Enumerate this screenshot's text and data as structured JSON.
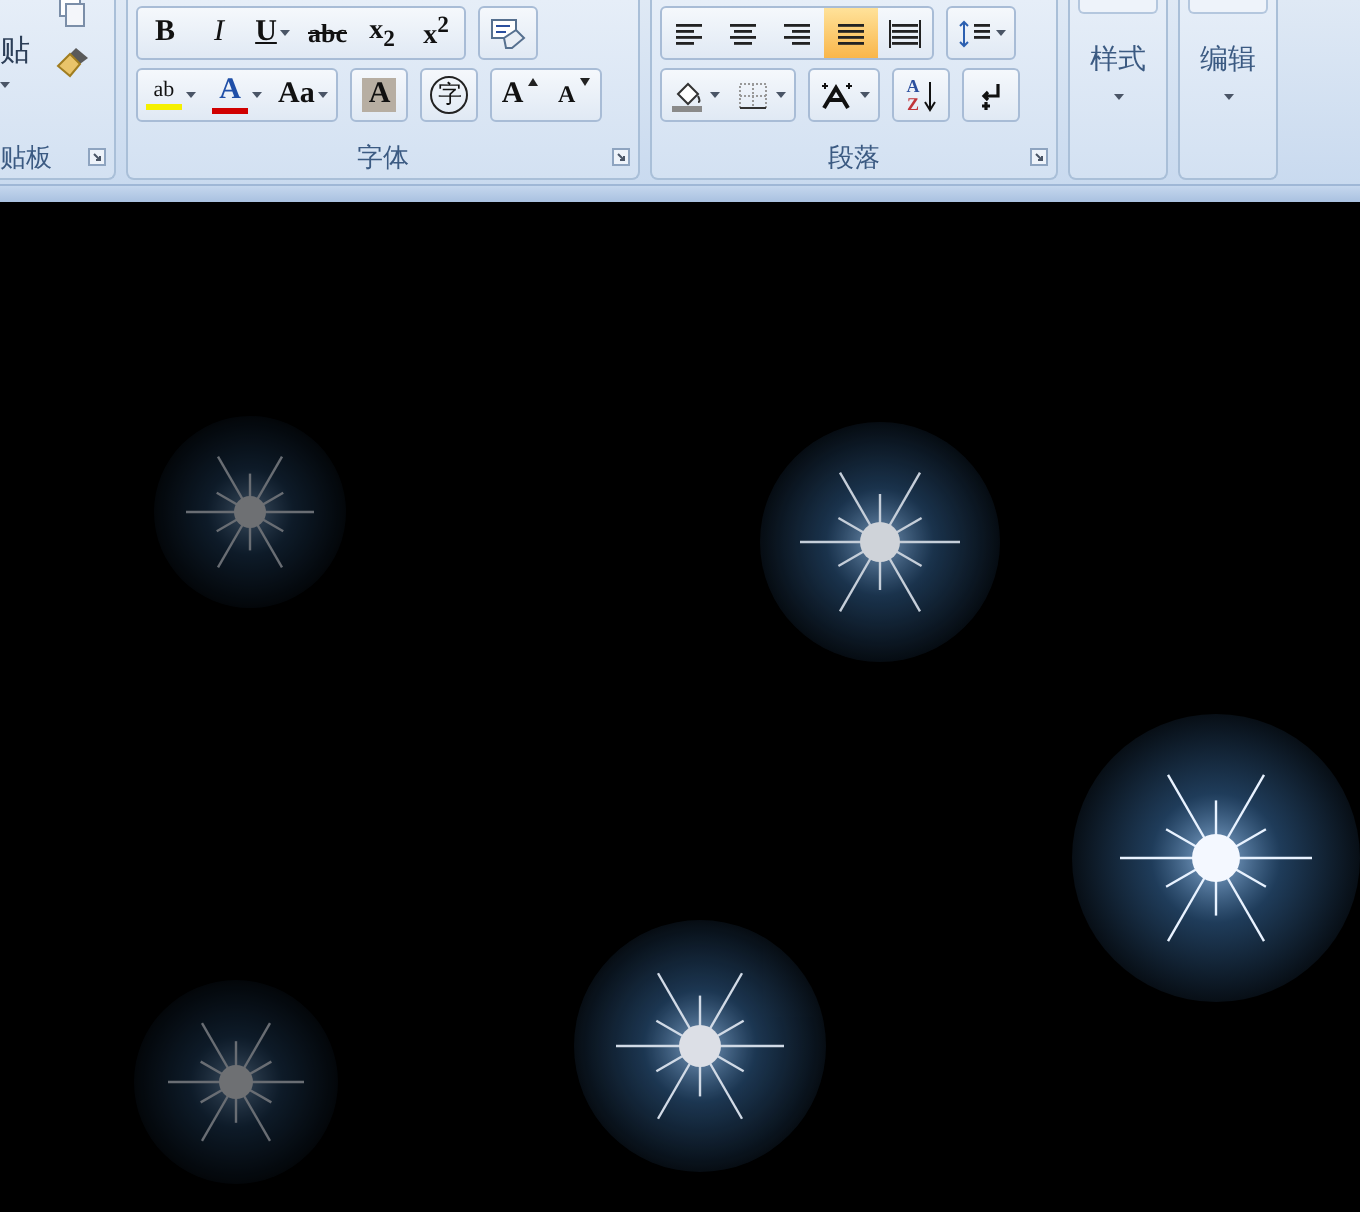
{
  "clipboard": {
    "paste_label": "贴",
    "label": "贴板",
    "launcher": true
  },
  "font": {
    "label": "字体",
    "launcher": true,
    "row1": [
      [
        {
          "kind": "bold",
          "text": "B",
          "has_menu": false
        },
        {
          "kind": "italic",
          "text": "I",
          "has_menu": false
        },
        {
          "kind": "underline",
          "text": "U",
          "has_menu": true
        },
        {
          "kind": "strike",
          "text": "abc",
          "has_menu": false
        },
        {
          "kind": "script",
          "text": "x$_{2}$",
          "has_menu": false
        },
        {
          "kind": "script",
          "text": "x$^{2}$",
          "has_menu": false
        }
      ],
      [
        {
          "kind": "clear_format",
          "has_menu": false
        }
      ]
    ],
    "row2": [
      [
        {
          "kind": "highlight",
          "text": "ab",
          "has_menu": true
        },
        {
          "kind": "font_color",
          "text": "A",
          "has_menu": true
        },
        {
          "kind": "plain",
          "text": "Aa",
          "has_menu": true
        }
      ],
      [
        {
          "kind": "shading",
          "text": "A",
          "has_menu": false
        }
      ],
      [
        {
          "kind": "enclosed",
          "text": "字",
          "has_menu": false
        }
      ],
      [
        {
          "kind": "grow",
          "text": "A",
          "has_menu": false
        },
        {
          "kind": "shrink",
          "text": "A",
          "has_menu": false
        }
      ]
    ]
  },
  "paragraph": {
    "label": "段落",
    "launcher": true,
    "row1": [
      [
        {
          "kind": "align_left",
          "selected": false,
          "has_menu": false
        },
        {
          "kind": "align_center",
          "selected": false,
          "has_menu": false
        },
        {
          "kind": "align_right",
          "selected": false,
          "has_menu": false
        },
        {
          "kind": "justify",
          "selected": true,
          "has_menu": false
        },
        {
          "kind": "distribute",
          "selected": false,
          "has_menu": false
        }
      ],
      [
        {
          "kind": "line_spacing",
          "has_menu": true
        }
      ]
    ],
    "row2": [
      [
        {
          "kind": "fill",
          "has_menu": true
        },
        {
          "kind": "borders",
          "has_menu": true
        }
      ],
      [
        {
          "kind": "asian_layout",
          "has_menu": true
        }
      ],
      [
        {
          "kind": "sort",
          "letters": [
            "A",
            "Z"
          ],
          "has_menu": false
        }
      ],
      [
        {
          "kind": "show_marks",
          "has_menu": false
        }
      ]
    ]
  },
  "styles": {
    "label": "样式"
  },
  "editing": {
    "label": "编辑"
  }
}
